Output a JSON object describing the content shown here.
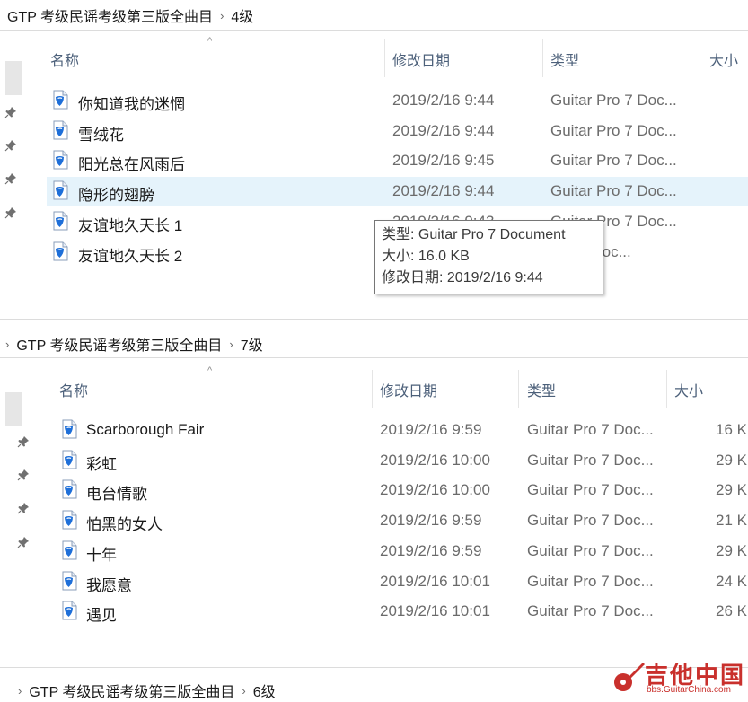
{
  "panel_4": {
    "breadcrumb": [
      "GTP 考级民谣考级第三版全曲目",
      "4级"
    ],
    "columns": {
      "name": "名称",
      "date": "修改日期",
      "type": "类型",
      "size": "大小"
    },
    "files": [
      {
        "name": "你知道我的迷惘",
        "date": "2019/2/16 9:44",
        "type": "Guitar Pro 7 Doc..."
      },
      {
        "name": "雪绒花",
        "date": "2019/2/16 9:44",
        "type": "Guitar Pro 7 Doc..."
      },
      {
        "name": "阳光总在风雨后",
        "date": "2019/2/16 9:45",
        "type": "Guitar Pro 7 Doc..."
      },
      {
        "name": "隐形的翅膀",
        "date": "2019/2/16 9:44",
        "type": "Guitar Pro 7 Doc...",
        "selected": true
      },
      {
        "name": "友谊地久天长 1",
        "date": "2019/2/16 9:43",
        "type": "Guitar Pro 7 Doc..."
      },
      {
        "name": "友谊地久天长 2",
        "date": "",
        "type": "Pro 7 Doc..."
      }
    ],
    "tooltip": {
      "type_line": "类型: Guitar Pro 7 Document",
      "size_line": "大小: 16.0 KB",
      "date_line": "修改日期: 2019/2/16 9:44"
    }
  },
  "panel_7": {
    "breadcrumb": [
      "GTP 考级民谣考级第三版全曲目",
      "7级"
    ],
    "columns": {
      "name": "名称",
      "date": "修改日期",
      "type": "类型",
      "size": "大小"
    },
    "files": [
      {
        "name": "Scarborough Fair",
        "date": "2019/2/16 9:59",
        "type": "Guitar Pro 7 Doc...",
        "size": "16 K"
      },
      {
        "name": "彩虹",
        "date": "2019/2/16 10:00",
        "type": "Guitar Pro 7 Doc...",
        "size": "29 K"
      },
      {
        "name": "电台情歌",
        "date": "2019/2/16 10:00",
        "type": "Guitar Pro 7 Doc...",
        "size": "29 K"
      },
      {
        "name": "怕黑的女人",
        "date": "2019/2/16 9:59",
        "type": "Guitar Pro 7 Doc...",
        "size": "21 K"
      },
      {
        "name": "十年",
        "date": "2019/2/16 9:59",
        "type": "Guitar Pro 7 Doc...",
        "size": "29 K"
      },
      {
        "name": "我愿意",
        "date": "2019/2/16 10:01",
        "type": "Guitar Pro 7 Doc...",
        "size": "24 K"
      },
      {
        "name": "遇见",
        "date": "2019/2/16 10:01",
        "type": "Guitar Pro 7 Doc...",
        "size": "26 K"
      }
    ]
  },
  "panel_6": {
    "breadcrumb": [
      "GTP 考级民谣考级第三版全曲目",
      "6级"
    ]
  },
  "watermark": {
    "title": "吉他中国",
    "subtitle": "bbs.GuitarChina.com"
  },
  "colors": {
    "selection": "#e5f3fb",
    "header_text": "#4c607a",
    "file_icon": "#1e6fd9",
    "watermark": "#c9302c"
  }
}
